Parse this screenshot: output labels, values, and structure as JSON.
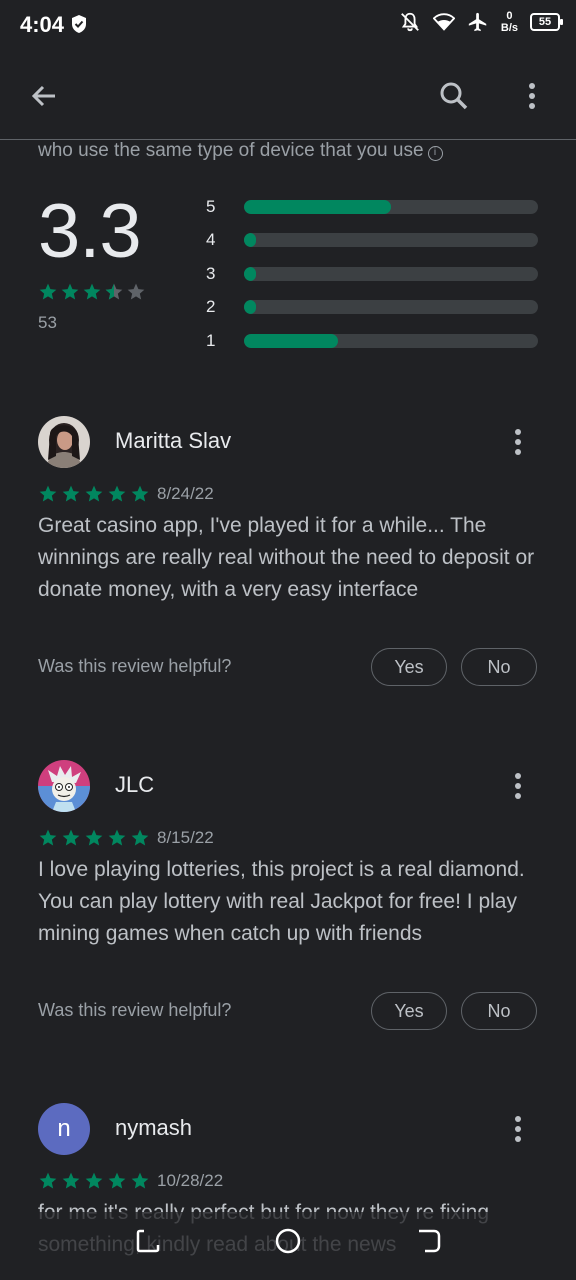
{
  "status_bar": {
    "time": "4:04",
    "net_speed_value": "0",
    "net_speed_unit": "B/s",
    "battery": "55"
  },
  "rating_summary": {
    "device_note": "who use the same type of device that you use",
    "average": "3.3",
    "average_value": 3.3,
    "count": "53",
    "histogram": [
      {
        "label": "5",
        "fraction": 0.5
      },
      {
        "label": "4",
        "fraction": 0.04
      },
      {
        "label": "3",
        "fraction": 0.04
      },
      {
        "label": "2",
        "fraction": 0.04
      },
      {
        "label": "1",
        "fraction": 0.32
      }
    ]
  },
  "reviews": [
    {
      "name": "Maritta Slav",
      "date": "8/24/22",
      "stars": 5,
      "text": "Great casino app, I've played it for a while... The winnings are really real without the need to deposit or donate money, with a very easy interface",
      "helpful_question": "Was this review helpful?",
      "yes_label": "Yes",
      "no_label": "No"
    },
    {
      "name": "JLC",
      "date": "8/15/22",
      "stars": 5,
      "text": "I love playing lotteries, this project is a real diamond. You can play lottery with real Jackpot for free! I play mining games when catch up with friends",
      "helpful_question": "Was this review helpful?",
      "yes_label": "Yes",
      "no_label": "No"
    },
    {
      "name": "nymash",
      "avatar_letter": "n",
      "date": "10/28/22",
      "stars": 5,
      "text": "for me it's really perfect but for now they re fixing something, kindly read about the news"
    }
  ],
  "colors": {
    "accent": "#01875f",
    "background": "#202124",
    "avatar_n": "#5c6bc0"
  },
  "icons": [
    "back-arrow-icon",
    "search-icon",
    "more-vert-icon",
    "star-icon",
    "info-icon"
  ]
}
